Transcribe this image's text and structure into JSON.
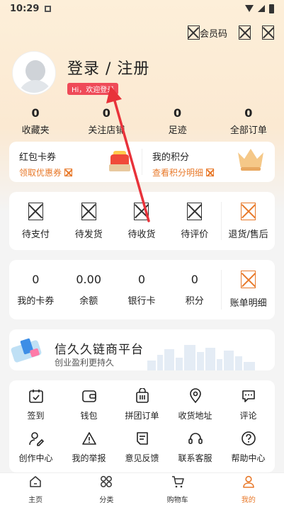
{
  "status_bar": {
    "time": "10:29"
  },
  "header": {
    "member_code_label": "会员码"
  },
  "profile": {
    "login_title": "登录 / 注册",
    "greeting_badge": "Hi，欢迎登录"
  },
  "stats": [
    {
      "value": "0",
      "label": "收藏夹"
    },
    {
      "value": "0",
      "label": "关注店铺"
    },
    {
      "value": "0",
      "label": "足迹"
    },
    {
      "value": "0",
      "label": "全部订单"
    }
  ],
  "promo": {
    "left": {
      "title": "红包卡券",
      "link": "领取优惠券"
    },
    "right": {
      "title": "我的积分",
      "link": "查看积分明细"
    }
  },
  "orders": [
    {
      "label": "待支付"
    },
    {
      "label": "待发货"
    },
    {
      "label": "待收货"
    },
    {
      "label": "待评价"
    },
    {
      "label": "退货/售后"
    }
  ],
  "wallet": [
    {
      "value": "0",
      "label": "我的卡券"
    },
    {
      "value": "0.00",
      "label": "余额"
    },
    {
      "value": "0",
      "label": "银行卡"
    },
    {
      "value": "0",
      "label": "积分"
    }
  ],
  "wallet_detail_label": "账单明细",
  "platform": {
    "title": "信久久链商平台",
    "subtitle": "创业盈利更持久"
  },
  "services": {
    "row1": [
      {
        "label": "签到",
        "icon": "calendar-check-icon"
      },
      {
        "label": "钱包",
        "icon": "wallet-icon"
      },
      {
        "label": "拼团订单",
        "icon": "group-bag-icon"
      },
      {
        "label": "收货地址",
        "icon": "location-pin-icon"
      },
      {
        "label": "评论",
        "icon": "comment-icon"
      }
    ],
    "row2": [
      {
        "label": "创作中心",
        "icon": "creator-icon"
      },
      {
        "label": "我的举报",
        "icon": "warning-icon"
      },
      {
        "label": "意见反馈",
        "icon": "feedback-icon"
      },
      {
        "label": "联系客服",
        "icon": "headset-icon"
      },
      {
        "label": "帮助中心",
        "icon": "help-icon"
      }
    ]
  },
  "tabbar": [
    {
      "label": "主页",
      "icon": "home-icon"
    },
    {
      "label": "分类",
      "icon": "category-icon"
    },
    {
      "label": "购物车",
      "icon": "cart-icon"
    },
    {
      "label": "我的",
      "icon": "user-icon",
      "active": true
    }
  ],
  "colors": {
    "accent": "#e8792a",
    "badge": "#ef4a58",
    "arrow": "#e8323a"
  }
}
